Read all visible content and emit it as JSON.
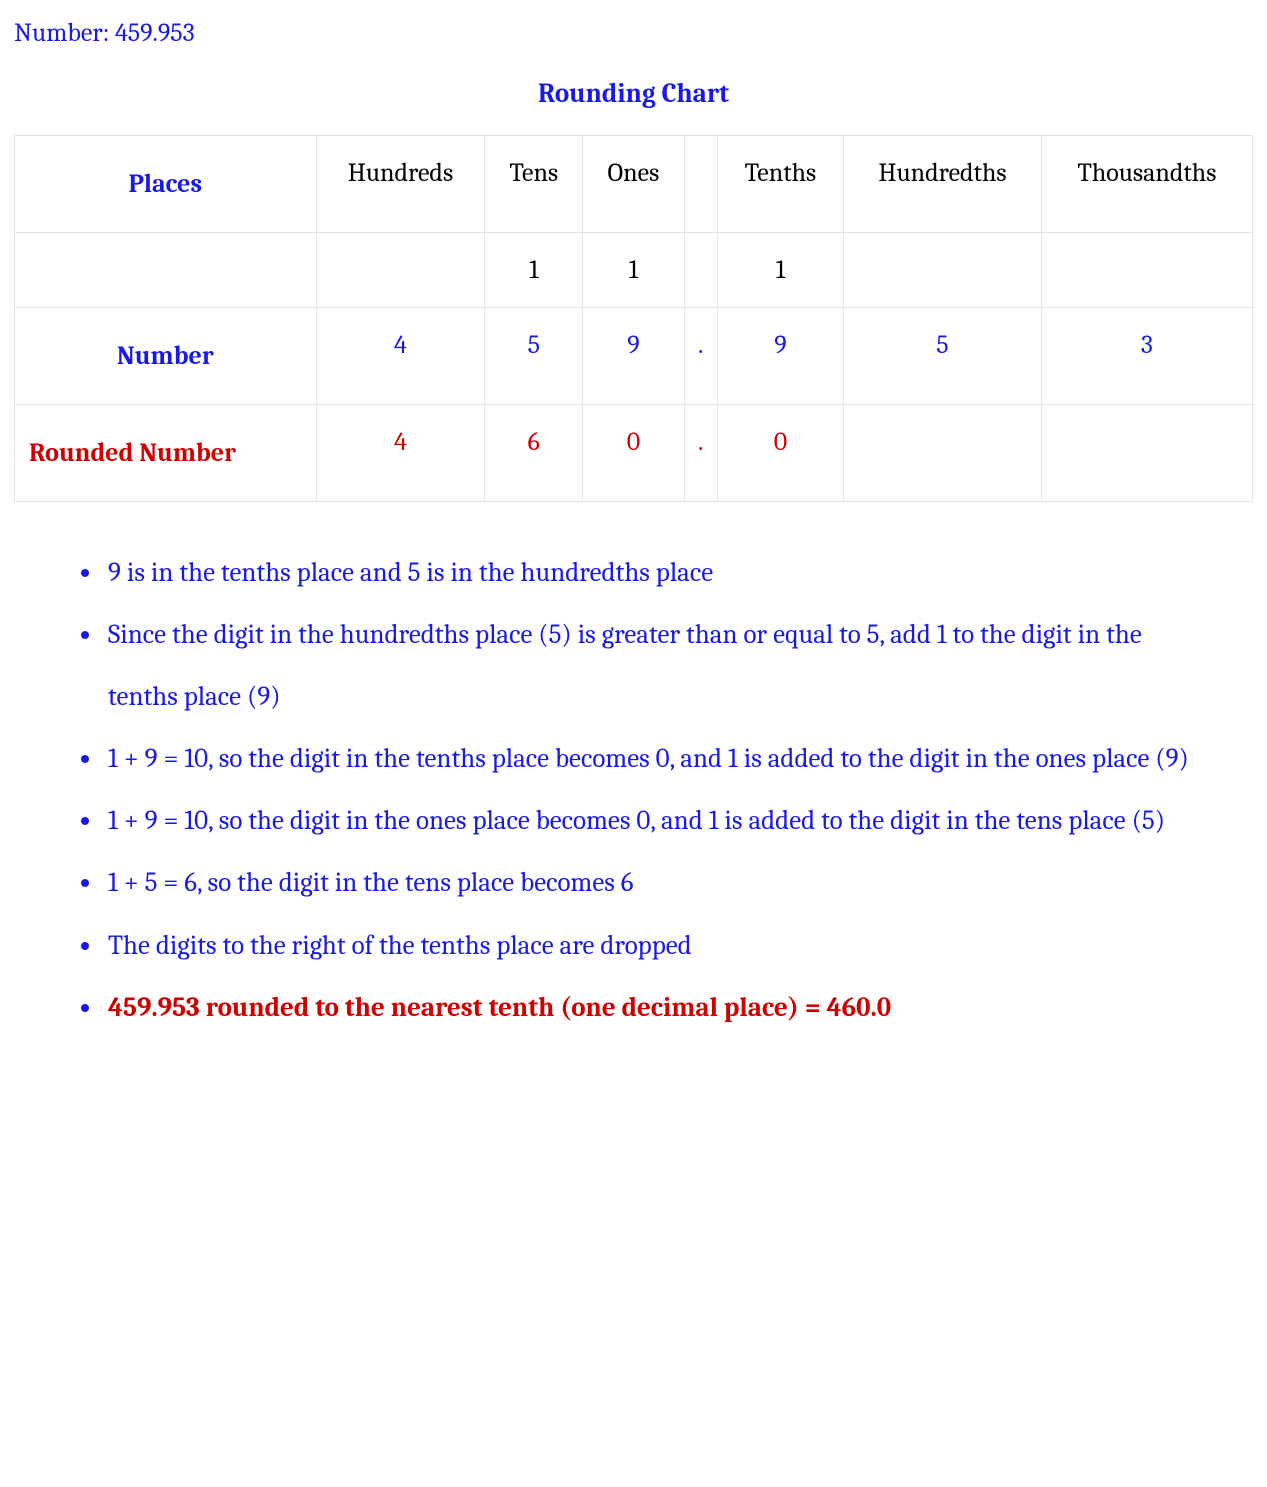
{
  "numberLabel": "Number: 459.953",
  "chartTitle": "Rounding Chart",
  "table": {
    "row1": {
      "label": "Places",
      "hundreds": "Hundreds",
      "tens": "Tens",
      "ones": "Ones",
      "dot": "",
      "tenths": "Tenths",
      "hundredths": "Hundredths",
      "thousandths": "Thousandths"
    },
    "row2": {
      "label": "",
      "hundreds": "",
      "tens": "1",
      "ones": "1",
      "dot": "",
      "tenths": "1",
      "hundredths": "",
      "thousandths": ""
    },
    "row3": {
      "label": "Number",
      "hundreds": "4",
      "tens": "5",
      "ones": "9",
      "dot": ".",
      "tenths": "9",
      "hundredths": "5",
      "thousandths": "3"
    },
    "row4": {
      "label": "Rounded Number",
      "hundreds": "4",
      "tens": "6",
      "ones": "0",
      "dot": ".",
      "tenths": "0",
      "hundredths": "",
      "thousandths": ""
    }
  },
  "bullets": {
    "b1": "9 is in the tenths place and 5 is in the hundredths place",
    "b2": "Since the digit in the hundredths place (5) is greater than or equal to 5, add 1 to the digit in the tenths place (9)",
    "b3": "1 + 9 = 10, so the digit in the tenths place becomes 0, and 1 is added to the digit in the ones place (9)",
    "b4": "1 + 9 = 10, so the digit in the ones place becomes 0, and 1 is added to the digit in the tens place (5)",
    "b5": "1 + 5 = 6, so the digit in the tens place becomes 6",
    "b6": "The digits to the right of the tenths place are dropped",
    "b7": "459.953 rounded to the nearest tenth (one decimal place) = 460.0"
  }
}
